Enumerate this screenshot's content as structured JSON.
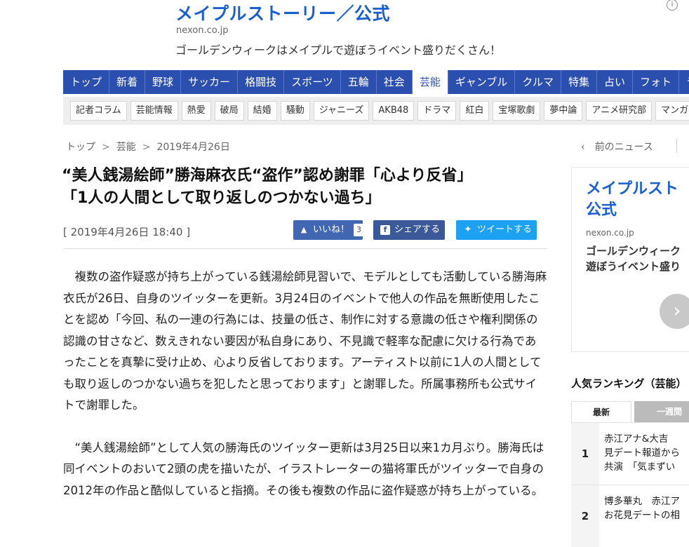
{
  "top_ad": {
    "title": "メイプルストーリー／公式",
    "url": "nexon.co.jp",
    "description": "ゴールデンウィークはメイプルで遊ぼうイベント盛りだくさん！"
  },
  "main_nav": [
    "トップ",
    "新着",
    "野球",
    "サッカー",
    "格闘技",
    "スポーツ",
    "五輪",
    "社会",
    "芸能",
    "ギャンブル",
    "クルマ",
    "特集",
    "占い",
    "フォト",
    "ラ"
  ],
  "main_nav_active": "芸能",
  "sub_nav": [
    "記者コラム",
    "芸能情報",
    "熱愛",
    "破局",
    "結婚",
    "騒動",
    "ジャニーズ",
    "AKB48",
    "ドラマ",
    "紅白",
    "宝塚歌劇",
    "夢中論",
    "アニメ研究部",
    "マンガ"
  ],
  "breadcrumb": {
    "home": "トップ",
    "category": "芸能",
    "date": "2019年4月26日",
    "sep": ">"
  },
  "prev_news": {
    "chevron": "‹",
    "label": "前のニュース"
  },
  "headline": {
    "line1": "“美人銭湯絵師”勝海麻衣氏“盗作”認め謝罪「心より反省」",
    "line2": "「1人の人間として取り返しのつかない過ち」"
  },
  "datetime": "[ 2019年4月26日 18:40 ]",
  "share": {
    "like_label": "いいね！",
    "like_count": "3",
    "facebook_label": "シェアする",
    "twitter_label": "ツイートする"
  },
  "article": {
    "p1": "複数の盗作疑惑が持ち上がっている銭湯絵師見習いで、モデルとしても活動している勝海麻衣氏が26日、自身のツイッターを更新。3月24日のイベントで他人の作品を無断使用したことを認め「今回、私の一連の行為には、技量の低さ、制作に対する意識の低さや権利関係の認識の甘さなど、数えきれない要因が私自身にあり、不見識で軽率な配慮に欠ける行為であったことを真摯に受け止め、心より反省しております。アーティスト以前に1人の人間としても取り返しのつかない過ちを犯したと思っております」と謝罪した。所属事務所も公式サイトで謝罪した。",
    "p2": "“美人銭湯絵師”として人気の勝海氏のツイッター更新は3月25日以来1カ月ぶり。勝海氏は同イベントのおいて2頭の虎を描いたが、イラストレーターの猫将軍氏がツイッターで自身の2012年の作品と酷似していると指摘。その後も複数の作品に盗作疑惑が持ち上がっている。"
  },
  "side_ad": {
    "title_line1": "メイプルスト",
    "title_line2": "公式",
    "url": "nexon.co.jp",
    "desc_line1": "ゴールデンウィーク",
    "desc_line2": "遊ぼうイベント盛り",
    "arrow": "›"
  },
  "ranking": {
    "title": "人気ランキング（芸能）",
    "tab_latest": "最新",
    "tab_week": "一週間",
    "items": [
      {
        "rank": "1",
        "line1": "赤江アナ&大吉",
        "line2": "見デート報道から",
        "line3": "共演　「気まずい"
      },
      {
        "rank": "2",
        "line1": "博多華丸　赤江ア",
        "line2": "お花見デートの相",
        "line3": ""
      }
    ]
  },
  "colors": {
    "brand_blue": "#2b4fae",
    "link_blue": "#1a5fd1",
    "facebook": "#3b5998",
    "twitter": "#1da1f2"
  }
}
